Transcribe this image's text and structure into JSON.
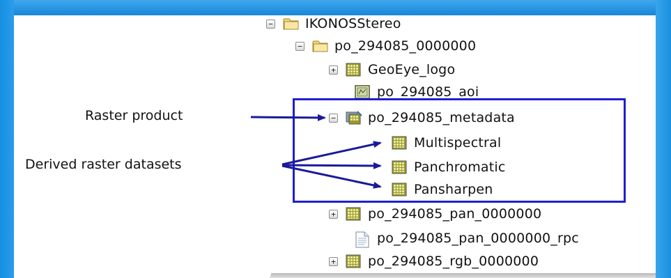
{
  "tree": {
    "items": [
      {
        "label": "IKONOSStereo",
        "icon": "folder-icon",
        "toggle": "minus"
      },
      {
        "label": "po_294085_0000000",
        "icon": "folder-icon",
        "toggle": "minus"
      },
      {
        "label": "GeoEye_logo",
        "icon": "raster-dataset-icon",
        "toggle": "plus"
      },
      {
        "label": "po_294085_aoi",
        "icon": "polygon-feature-icon",
        "toggle": ""
      },
      {
        "label": "po_294085_metadata",
        "icon": "raster-product-icon",
        "toggle": "minus"
      },
      {
        "label": "Multispectral",
        "icon": "raster-dataset-icon",
        "toggle": ""
      },
      {
        "label": "Panchromatic",
        "icon": "raster-dataset-icon",
        "toggle": ""
      },
      {
        "label": "Pansharpen",
        "icon": "raster-dataset-icon",
        "toggle": ""
      },
      {
        "label": "po_294085_pan_0000000",
        "icon": "raster-dataset-icon",
        "toggle": "plus"
      },
      {
        "label": "po_294085_pan_0000000_rpc",
        "icon": "text-file-icon",
        "toggle": ""
      },
      {
        "label": "po_294085_rgb_0000000",
        "icon": "raster-dataset-icon",
        "toggle": "plus"
      }
    ]
  },
  "callouts": {
    "raster_product": "Raster product",
    "derived_datasets": "Derived raster datasets"
  },
  "colors": {
    "frame": "#1a8fe0",
    "highlight_box": "#1f1fd0",
    "arrow": "#1a1a99"
  }
}
